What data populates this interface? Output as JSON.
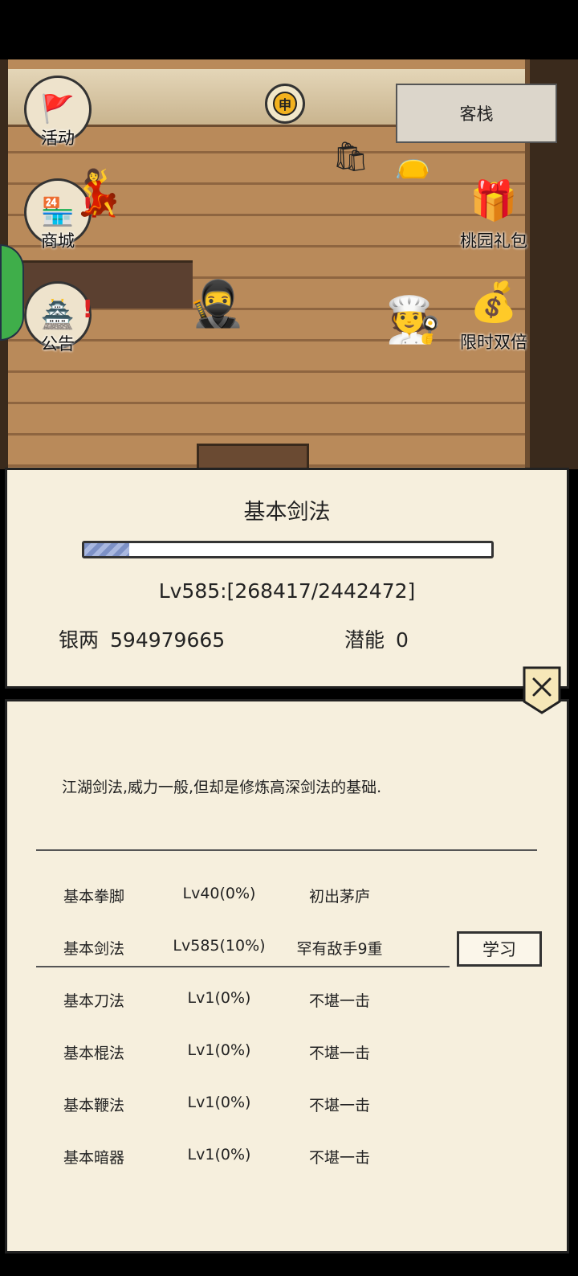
{
  "scene": {
    "sun_badge": "申",
    "inn_button": "客栈",
    "left_menu": [
      {
        "label": "活动",
        "icon": "activity-flag-icon",
        "alert": ""
      },
      {
        "label": "商城",
        "icon": "shop-icon",
        "alert": "!"
      },
      {
        "label": "公告",
        "icon": "announcement-icon",
        "alert": "!"
      }
    ],
    "right_menu": [
      {
        "label": "桃园礼包",
        "icon": "gift-box-icon"
      },
      {
        "label": "限时双倍",
        "icon": "treasure-chest-icon"
      }
    ]
  },
  "skill_panel": {
    "title": "基本剑法",
    "progress_fraction": 0.11,
    "level_text": "Lv585:[268417/2442472]",
    "silver_label": "银两",
    "silver_value": "594979665",
    "potential_label": "潜能",
    "potential_value": "0"
  },
  "detail_panel": {
    "close_icon": "close-icon",
    "description": "江湖剑法,威力一般,但却是修炼高深剑法的基础.",
    "skills": [
      {
        "name": "基本拳脚",
        "level": "Lv40(0%)",
        "rank": "初出茅庐"
      },
      {
        "name": "基本剑法",
        "level": "Lv585(10%)",
        "rank": "罕有敌手9重"
      },
      {
        "name": "基本刀法",
        "level": "Lv1(0%)",
        "rank": "不堪一击"
      },
      {
        "name": "基本棍法",
        "level": "Lv1(0%)",
        "rank": "不堪一击"
      },
      {
        "name": "基本鞭法",
        "level": "Lv1(0%)",
        "rank": "不堪一击"
      },
      {
        "name": "基本暗器",
        "level": "Lv1(0%)",
        "rank": "不堪一击"
      }
    ],
    "learn_button": "学习",
    "selected_index": 1
  },
  "colors": {
    "panel_bg": "#f6efdd",
    "progress_fill": "#7d91c6",
    "wood": "#b98a5a"
  }
}
